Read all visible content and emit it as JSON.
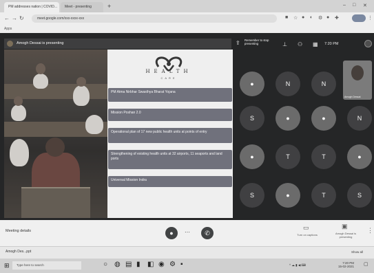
{
  "browser": {
    "tabs": [
      {
        "label": "PM addresses nation | COVID..."
      },
      {
        "label": "Meet - presenting"
      }
    ],
    "new_tab": "+",
    "url": "meet.google.com/xxx-xxxx-xxx",
    "bookmarks": "Apps"
  },
  "meet": {
    "presenter_label": "Amogh Dessai is presenting",
    "present_note": "Remember to stop presenting",
    "clock": "7:20 PM",
    "participants": [
      "N",
      "N",
      "S",
      "N",
      "T",
      "T",
      "T",
      "S",
      "S"
    ],
    "pinned_name": "Amogh Dessai"
  },
  "slide": {
    "logo_text": "HEALTH",
    "logo_sub": "CARE",
    "bullets": [
      "PM Atma Nirbhar Swasthya Bharat Yojana",
      "Mission Poshan 2.0",
      "Operational plan of 17 new public health units at points of entry",
      "Strengthening of existing health units at 32 airports, 11 seaports and land ports",
      "Universal Mission Indra"
    ]
  },
  "controls": {
    "meeting_title": "Meeting details",
    "hangup": "✆",
    "more": "⋯",
    "captions_label": "Turn on captions",
    "presenting_label": "Amogh Dessai is presenting"
  },
  "downloads": {
    "item": "Amogh Des...ppt",
    "show_all": "Show all"
  },
  "taskbar": {
    "search_placeholder": "Type here to search",
    "time": "7:20 PM",
    "date": "15-02-2021"
  },
  "colors": {
    "meet_bg": "#202124",
    "bullet_bg": "#6d6f8a",
    "slide_bg": "#f5f5f5"
  }
}
